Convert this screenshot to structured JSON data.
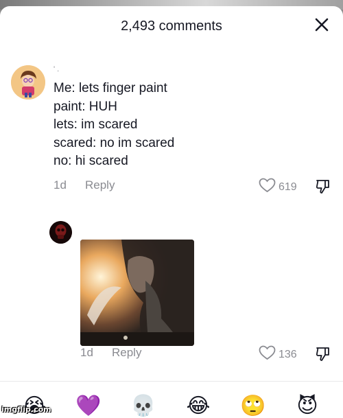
{
  "header": {
    "title": "2,493 comments"
  },
  "comments": [
    {
      "username": "' .",
      "lines": [
        "Me: lets finger paint",
        "paint: HUH",
        "lets: im scared",
        "scared: no im scared",
        "no: hi scared"
      ],
      "age": "1d",
      "reply_label": "Reply",
      "likes": "619"
    },
    {
      "age": "1d",
      "reply_label": "Reply",
      "likes": "136"
    }
  ],
  "emojis": [
    "😭",
    "💜",
    "💀",
    "😂",
    "🙄",
    "😈"
  ],
  "watermark": "imgflip.com",
  "icons": {
    "close": "close-icon",
    "like": "heart-outline-icon",
    "dislike": "thumbs-down-icon"
  }
}
